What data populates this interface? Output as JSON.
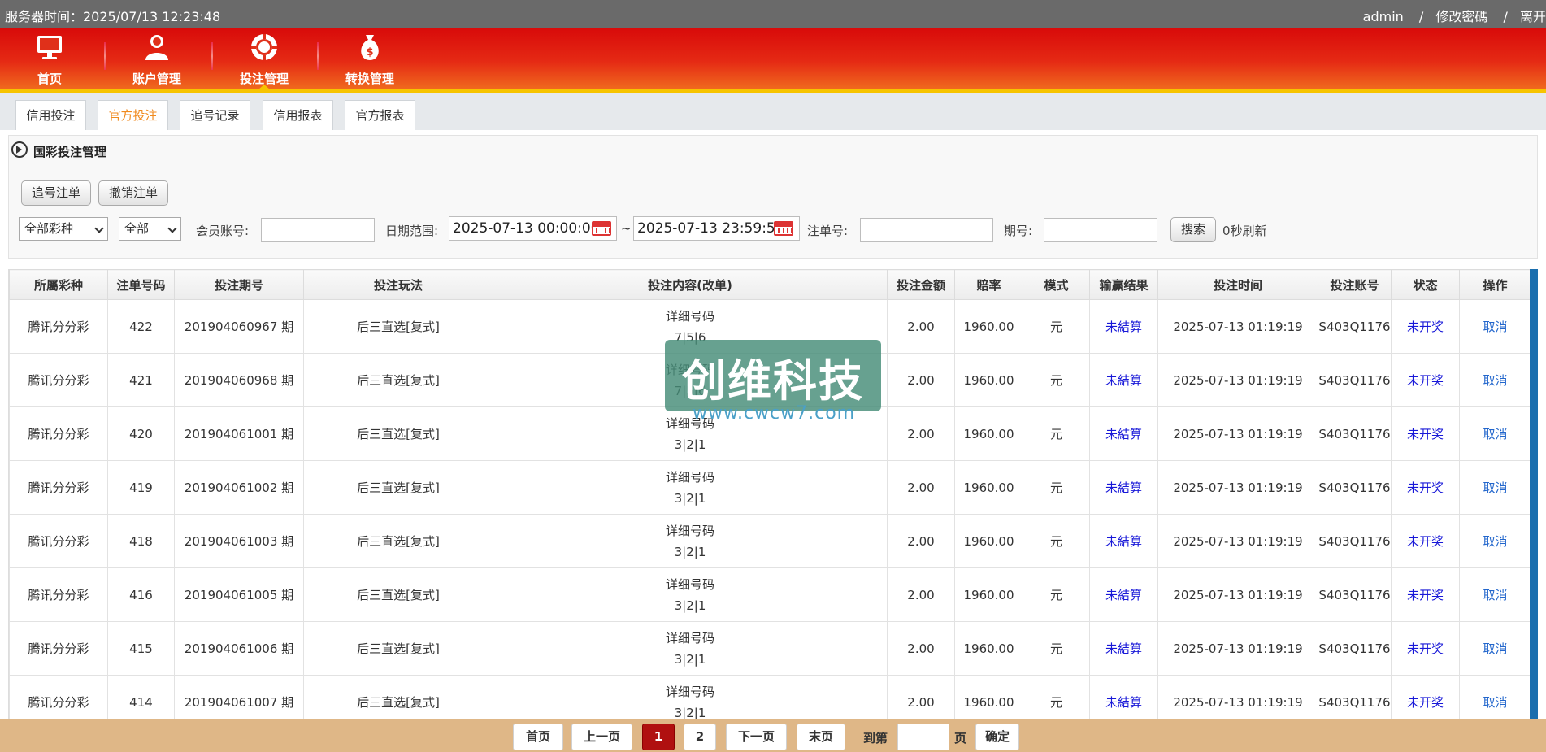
{
  "topbar": {
    "server_time": "服务器时间：2025/07/13 12:23:48",
    "user": "admin",
    "sep1": "/",
    "change_password": "修改密碼",
    "sep2": "/",
    "logout": "离开"
  },
  "nav": {
    "items": [
      {
        "label": "首页",
        "icon": "monitor-icon"
      },
      {
        "label": "账户管理",
        "icon": "user-icon"
      },
      {
        "label": "投注管理",
        "icon": "chip-icon"
      },
      {
        "label": "转换管理",
        "icon": "money-bag-icon"
      }
    ],
    "active": "投注管理"
  },
  "tabs": [
    {
      "label": "信用投注"
    },
    {
      "label": "官方投注"
    },
    {
      "label": "追号记录"
    },
    {
      "label": "信用报表"
    },
    {
      "label": "官方报表"
    }
  ],
  "active_tab": "官方投注",
  "panel": {
    "title": "国彩投注管理",
    "chase_button": "追号注单",
    "cancel_button": "撤销注单",
    "lottery_select": "全部彩种",
    "status_select": "全部",
    "member_label": "会员账号:",
    "member_value": "",
    "date_label": "日期范围:",
    "date_from": "2025-07-13 00:00:00",
    "tilde": "~",
    "date_to": "2025-07-13 23:59:59",
    "order_label": "注单号:",
    "order_value": "",
    "period_label": "期号:",
    "period_value": "",
    "search_button": "搜索",
    "refresh_text": "0秒刷新"
  },
  "table": {
    "headers": [
      "所屬彩种",
      "注单号码",
      "投注期号",
      "投注玩法",
      "投注内容(改单)",
      "投注金额",
      "賠率",
      "模式",
      "输赢结果",
      "投注时间",
      "投注账号",
      "状态",
      "操作"
    ],
    "rows": [
      {
        "lottery": "腾讯分分彩",
        "order": "422",
        "period": "201904060967 期",
        "play": "后三直选[复式]",
        "detail": "详细号码",
        "numbers": "7|5|6",
        "amount": "2.00",
        "odds": "1960.00",
        "mode": "元",
        "result": "未結算",
        "time": "2025-07-13 01:19:19",
        "account": "S403Q1176",
        "status": "未开奖",
        "action": "取消"
      },
      {
        "lottery": "腾讯分分彩",
        "order": "421",
        "period": "201904060968 期",
        "play": "后三直选[复式]",
        "detail": "详细号码",
        "numbers": "7|5|6",
        "amount": "2.00",
        "odds": "1960.00",
        "mode": "元",
        "result": "未結算",
        "time": "2025-07-13 01:19:19",
        "account": "S403Q1176",
        "status": "未开奖",
        "action": "取消"
      },
      {
        "lottery": "腾讯分分彩",
        "order": "420",
        "period": "201904061001 期",
        "play": "后三直选[复式]",
        "detail": "详细号码",
        "numbers": "3|2|1",
        "amount": "2.00",
        "odds": "1960.00",
        "mode": "元",
        "result": "未結算",
        "time": "2025-07-13 01:19:19",
        "account": "S403Q1176",
        "status": "未开奖",
        "action": "取消"
      },
      {
        "lottery": "腾讯分分彩",
        "order": "419",
        "period": "201904061002 期",
        "play": "后三直选[复式]",
        "detail": "详细号码",
        "numbers": "3|2|1",
        "amount": "2.00",
        "odds": "1960.00",
        "mode": "元",
        "result": "未結算",
        "time": "2025-07-13 01:19:19",
        "account": "S403Q1176",
        "status": "未开奖",
        "action": "取消"
      },
      {
        "lottery": "腾讯分分彩",
        "order": "418",
        "period": "201904061003 期",
        "play": "后三直选[复式]",
        "detail": "详细号码",
        "numbers": "3|2|1",
        "amount": "2.00",
        "odds": "1960.00",
        "mode": "元",
        "result": "未結算",
        "time": "2025-07-13 01:19:19",
        "account": "S403Q1176",
        "status": "未开奖",
        "action": "取消"
      },
      {
        "lottery": "腾讯分分彩",
        "order": "416",
        "period": "201904061005 期",
        "play": "后三直选[复式]",
        "detail": "详细号码",
        "numbers": "3|2|1",
        "amount": "2.00",
        "odds": "1960.00",
        "mode": "元",
        "result": "未結算",
        "time": "2025-07-13 01:19:19",
        "account": "S403Q1176",
        "status": "未开奖",
        "action": "取消"
      },
      {
        "lottery": "腾讯分分彩",
        "order": "415",
        "period": "201904061006 期",
        "play": "后三直选[复式]",
        "detail": "详细号码",
        "numbers": "3|2|1",
        "amount": "2.00",
        "odds": "1960.00",
        "mode": "元",
        "result": "未結算",
        "time": "2025-07-13 01:19:19",
        "account": "S403Q1176",
        "status": "未开奖",
        "action": "取消"
      },
      {
        "lottery": "腾讯分分彩",
        "order": "414",
        "period": "201904061007 期",
        "play": "后三直选[复式]",
        "detail": "详细号码",
        "numbers": "3|2|1",
        "amount": "2.00",
        "odds": "1960.00",
        "mode": "元",
        "result": "未結算",
        "time": "2025-07-13 01:19:19",
        "account": "S403Q1176",
        "status": "未开奖",
        "action": "取消"
      }
    ]
  },
  "watermark": {
    "text": "创维科技",
    "sub": "www.cwcw7.com"
  },
  "pager": {
    "first": "首页",
    "prev": "上一页",
    "page1": "1",
    "page2": "2",
    "next": "下一页",
    "last": "末页",
    "goto_label": "到第",
    "goto_value": "",
    "page_suffix": "页",
    "confirm": "确定"
  },
  "colors": {
    "header_red": "#d80a0a",
    "accent_yellow": "#f7c400",
    "tab_active": "#f08a1e",
    "status_blue": "#1818d8",
    "pager_bg": "#dfb787"
  }
}
